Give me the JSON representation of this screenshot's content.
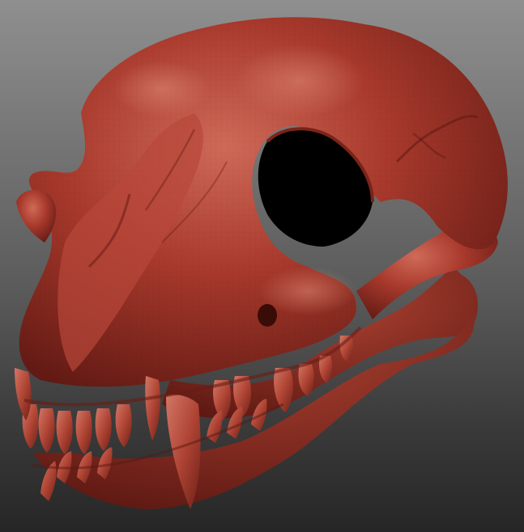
{
  "viewport": {
    "background_top": "#8f8f8f",
    "background_bottom": "#262626"
  },
  "model": {
    "subject": "sculpted-carnivore-skull",
    "base_color": "#a8392c",
    "highlight_color": "#cf6a58",
    "shadow_color": "#5e1812",
    "eye_socket_color": "#000000",
    "tooth_color": "#b64a3c"
  }
}
